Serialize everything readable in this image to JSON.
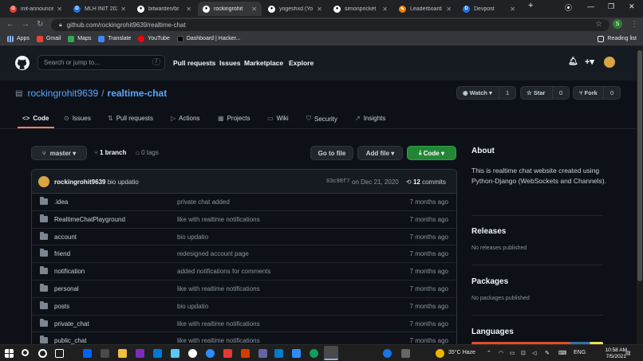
{
  "browser": {
    "tabs": [
      {
        "label": "init-announce",
        "favicon": "chrome-icon",
        "color": "#e34133"
      },
      {
        "label": "MLH INIT 202",
        "favicon": "devpost-icon",
        "color": "#1a73e8"
      },
      {
        "label": "bitwarden/br",
        "favicon": "github-icon",
        "color": "#ffffff"
      },
      {
        "label": "rockingrohit",
        "favicon": "github-icon",
        "color": "#ffffff"
      },
      {
        "label": "yogeshxd (Yo",
        "favicon": "github-icon",
        "color": "#ffffff"
      },
      {
        "label": "simonpricket",
        "favicon": "github-icon",
        "color": "#ffffff"
      },
      {
        "label": "Leaderboard",
        "favicon": "leaderboard-icon",
        "color": "#f57c00"
      },
      {
        "label": "Devpost",
        "favicon": "devpost-icon",
        "color": "#1a73e8"
      }
    ],
    "new_tab": "+",
    "address": "github.com/rockingrohit9639/realtime-chat",
    "profile_initial": "S",
    "bookmarks": [
      {
        "label": "Apps",
        "icon": "apps-grid-icon",
        "color": "#8ab4f8"
      },
      {
        "label": "Gmail",
        "icon": "gmail-icon",
        "color": "#ea4335"
      },
      {
        "label": "Maps",
        "icon": "maps-icon",
        "color": "#34a853"
      },
      {
        "label": "Translate",
        "icon": "translate-icon",
        "color": "#4285f4"
      },
      {
        "label": "YouTube",
        "icon": "youtube-icon",
        "color": "#ff0000"
      },
      {
        "label": "Dashboard | Hacker...",
        "icon": "dashboard-icon",
        "color": "#202124"
      }
    ],
    "reading_list": "Reading list"
  },
  "github": {
    "search_placeholder": "Search or jump to...",
    "search_shortcut": "/",
    "nav": [
      "Pull requests",
      "Issues",
      "Marketplace",
      "Explore"
    ]
  },
  "repo": {
    "owner": "rockingrohit9639",
    "separator": "/",
    "name": "realtime-chat",
    "watch": {
      "label": "Watch",
      "count": "1"
    },
    "star": {
      "label": "Star",
      "count": "0"
    },
    "fork": {
      "label": "Fork",
      "count": "0"
    },
    "tabs": [
      {
        "label": "Code",
        "icon": "<>"
      },
      {
        "label": "Issues",
        "icon": "⊙"
      },
      {
        "label": "Pull requests",
        "icon": "⇅"
      },
      {
        "label": "Actions",
        "icon": "▷"
      },
      {
        "label": "Projects",
        "icon": "▦"
      },
      {
        "label": "Wiki",
        "icon": "▭"
      },
      {
        "label": "Security",
        "icon": "⛉"
      },
      {
        "label": "Insights",
        "icon": "↗"
      }
    ],
    "branch": "master",
    "branches": "1 branch",
    "tags": "0 tags",
    "go_to_file": "Go to file",
    "add_file": "Add file",
    "code_button": "Code",
    "latest_commit": {
      "author": "rockingrohit9639",
      "message": "bio updatio",
      "sha": "83c98f7",
      "date": "on Dec 21, 2020",
      "commits_count": "12",
      "commits_label": "commits"
    },
    "files": [
      {
        "name": ".idea",
        "message": "private chat added",
        "age": "7 months ago"
      },
      {
        "name": "RealtimeChatPlayground",
        "message": "like with realtime notifications",
        "age": "7 months ago"
      },
      {
        "name": "account",
        "message": "bio updatio",
        "age": "7 months ago"
      },
      {
        "name": "friend",
        "message": "redesigned account page",
        "age": "7 months ago"
      },
      {
        "name": "notification",
        "message": "added notifications for comments",
        "age": "7 months ago"
      },
      {
        "name": "personal",
        "message": "like with realtime notifications",
        "age": "7 months ago"
      },
      {
        "name": "posts",
        "message": "bio updatio",
        "age": "7 months ago"
      },
      {
        "name": "private_chat",
        "message": "like with realtime notifications",
        "age": "7 months ago"
      },
      {
        "name": "public_chat",
        "message": "like with realtime notifications",
        "age": "7 months ago"
      }
    ],
    "about": {
      "heading": "About",
      "description": "This is realtime chat website created using Python-Django (WebSockets and Channels)."
    },
    "releases": {
      "heading": "Releases",
      "text": "No releases published"
    },
    "packages": {
      "heading": "Packages",
      "text": "No packages published"
    },
    "languages": {
      "heading": "Languages"
    }
  },
  "taskbar": {
    "weather": "35°C  Haze",
    "language": "ENG",
    "time": "10:58 AM",
    "date": "7/5/2021"
  },
  "colors": {
    "accent": "#58a6ff",
    "green": "#238636",
    "tab_underline": "#f78166"
  }
}
